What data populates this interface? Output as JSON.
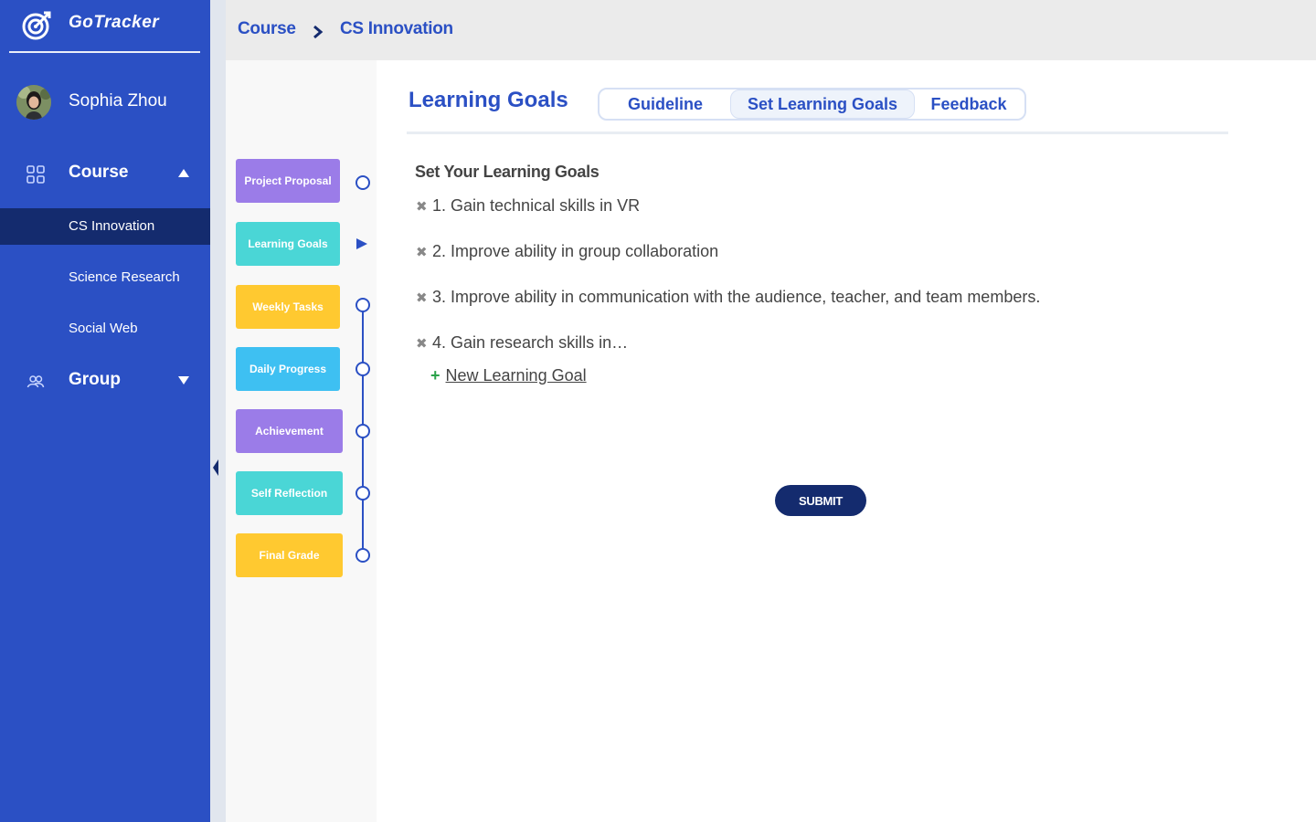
{
  "app": {
    "name": "GoTracker"
  },
  "user": {
    "name": "Sophia Zhou"
  },
  "sidebar": {
    "sections": [
      {
        "label": "Course",
        "expanded": true,
        "items": [
          {
            "label": "CS Innovation",
            "active": true
          },
          {
            "label": "Science Research",
            "active": false
          },
          {
            "label": "Social Web",
            "active": false
          }
        ]
      },
      {
        "label": "Group",
        "expanded": false,
        "items": []
      }
    ]
  },
  "breadcrumb": {
    "items": [
      "Course",
      "CS Innovation"
    ]
  },
  "steps": [
    {
      "label": "Project Proposal",
      "color": "#9b7ce8"
    },
    {
      "label": "Learning Goals",
      "color": "#4ad6d6",
      "current": true
    },
    {
      "label": "Weekly Tasks",
      "color": "#ffc930"
    },
    {
      "label": "Daily Progress",
      "color": "#3ec0f2"
    },
    {
      "label": "Achievement",
      "color": "#9b7ce8"
    },
    {
      "label": "Self Reflection",
      "color": "#4ad6d6"
    },
    {
      "label": "Final Grade",
      "color": "#ffc930"
    }
  ],
  "main": {
    "title": "Learning Goals",
    "tabs": [
      {
        "label": "Guideline",
        "active": false
      },
      {
        "label": "Set Learning Goals",
        "active": true
      },
      {
        "label": "Feedback",
        "active": false
      }
    ],
    "section_heading": "Set Your Learning Goals",
    "goals": [
      "1. Gain technical skills in VR",
      "2. Improve ability in group collaboration",
      "3. Improve ability in communication with the audience, teacher, and team members.",
      "4. Gain research skills in…"
    ],
    "new_goal_label": "New Learning Goal",
    "submit_label": "SUBMIT"
  },
  "colors": {
    "sidebar": "#2b50c4",
    "active_nav": "#142b6e",
    "accent": "#2b50c4",
    "submit": "#142b6e",
    "add": "#2aa24a"
  },
  "icons": {
    "brand": "target-icon",
    "course": "grid-icon",
    "group": "group-icon",
    "remove": "close-icon",
    "add": "plus-icon"
  }
}
